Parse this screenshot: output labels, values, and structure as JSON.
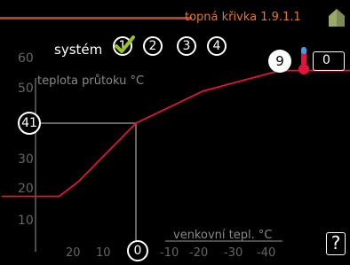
{
  "header": {
    "title": "topná křivka 1.9.1.1",
    "accent_color": "#e07a2a",
    "home_icon": "house-icon"
  },
  "system": {
    "label": "systém",
    "options": [
      "1",
      "2",
      "3",
      "4"
    ],
    "selected": "1"
  },
  "controls": {
    "curve_slope": "9",
    "offset": "0",
    "help": "?",
    "thermometer_icon": "thermometer-icon"
  },
  "markers": {
    "flow_temp": "41",
    "outdoor_temp": "0"
  },
  "chart_data": {
    "type": "line",
    "ylabel": "teplota průtoku °C",
    "xlabel": "venkovní tepl. °C",
    "yticks": [
      "60",
      "50",
      "40",
      "30",
      "20",
      "10"
    ],
    "xticks": [
      "20",
      "10",
      "0",
      "-10",
      "-20",
      "-30",
      "-40"
    ],
    "x_reversed": true,
    "ylim": [
      5,
      62
    ],
    "xlim": [
      28,
      -47
    ],
    "series": [
      {
        "color": "#e0143c",
        "x": [
          28,
          16,
          12,
          0,
          -14,
          -30,
          -47
        ],
        "y": [
          16,
          16,
          21,
          41,
          52,
          59,
          59
        ]
      }
    ],
    "selected_point": {
      "x": 0,
      "y": 41
    }
  }
}
